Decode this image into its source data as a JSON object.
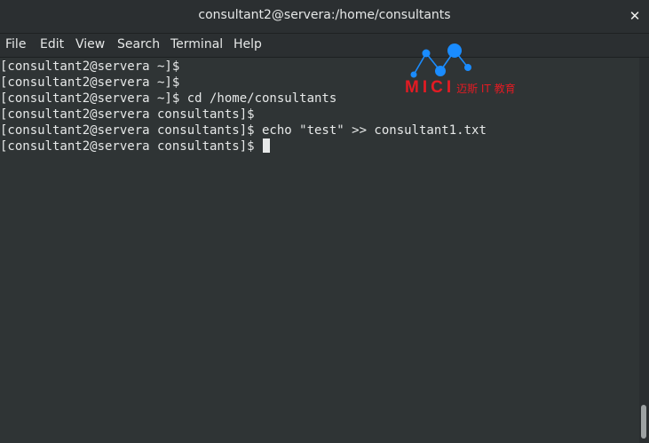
{
  "window": {
    "title": "consultant2@servera:/home/consultants",
    "close_glyph": "✕"
  },
  "menu": {
    "items": [
      "File",
      "Edit",
      "View",
      "Search",
      "Terminal",
      "Help"
    ]
  },
  "terminal": {
    "lines": [
      "[consultant2@servera ~]$",
      "[consultant2@servera ~]$",
      "[consultant2@servera ~]$ cd /home/consultants",
      "[consultant2@servera consultants]$",
      "[consultant2@servera consultants]$ echo \"test\" >> consultant1.txt",
      "[consultant2@servera consultants]$ "
    ]
  },
  "watermark": {
    "brand": "MICI",
    "subtitle": "迈斯 IT 教育",
    "color": "#e31b23",
    "node_color": "#1a8cff"
  },
  "colors": {
    "background": "#2f3435",
    "text": "#e6e8e8"
  }
}
